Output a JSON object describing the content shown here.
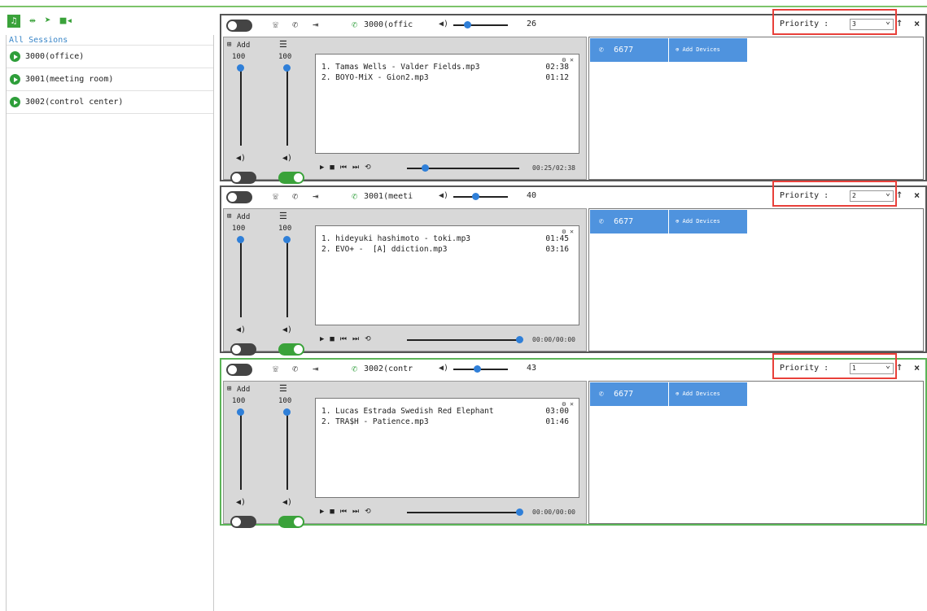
{
  "toolbar": {
    "icons": [
      "app-icon",
      "network-icon",
      "location-icon",
      "video-icon"
    ]
  },
  "sidebar": {
    "header": "All Sessions",
    "items": [
      {
        "label": "3000(office)"
      },
      {
        "label": "3001(meeting room)"
      },
      {
        "label": "3002(control center)"
      }
    ]
  },
  "panels": [
    {
      "session": "3000(offic",
      "volume": "26",
      "priority_label": "Priority :",
      "priority": "3",
      "add_label": "Add",
      "vol_a": "100",
      "vol_b": "100",
      "tracks": [
        {
          "name": "1. Tamas Wells - Valder Fields.mp3",
          "time": "02:38"
        },
        {
          "name": "2. BOYO-MiX - Gion2.mp3",
          "time": "01:12"
        }
      ],
      "progress_time": "00:25/02:38",
      "progress": 0.16,
      "device": "6677",
      "add_devices": "Add Devices"
    },
    {
      "session": "3001(meeti",
      "volume": "40",
      "priority_label": "Priority :",
      "priority": "2",
      "add_label": "Add",
      "vol_a": "100",
      "vol_b": "100",
      "tracks": [
        {
          "name": "1. hideyuki hashimoto - toki.mp3",
          "time": "01:45"
        },
        {
          "name": "2. EVO+ -  [A] ddiction.mp3",
          "time": "03:16"
        }
      ],
      "progress_time": "00:00/00:00",
      "progress": 1.0,
      "device": "6677",
      "add_devices": "Add Devices"
    },
    {
      "session": "3002(contr",
      "volume": "43",
      "priority_label": "Priority :",
      "priority": "1",
      "add_label": "Add",
      "vol_a": "100",
      "vol_b": "100",
      "tracks": [
        {
          "name": "1. Lucas Estrada Swedish Red Elephant",
          "time": "03:00"
        },
        {
          "name": "2. TRA$H - Patience.mp3",
          "time": "01:46"
        }
      ],
      "progress_time": "00:00/00:00",
      "progress": 1.0,
      "device": "6677",
      "add_devices": "Add Devices"
    }
  ],
  "colors": {
    "accent": "#3aa23a",
    "highlight": "#e8403a",
    "device": "#4f93de"
  }
}
